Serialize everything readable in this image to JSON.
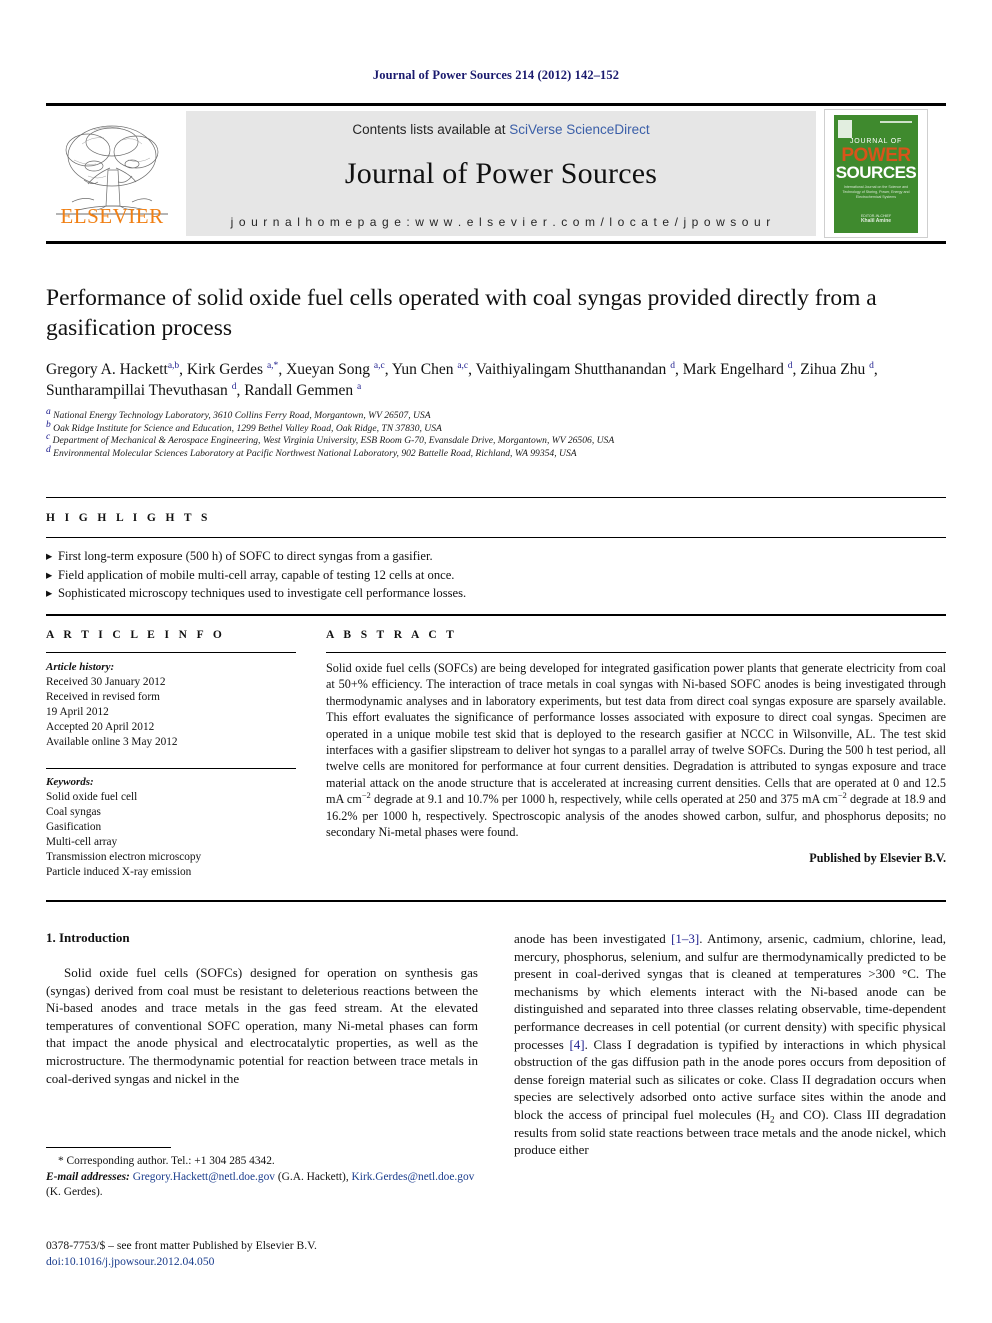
{
  "running_head": "Journal of Power Sources 214 (2012) 142–152",
  "masthead": {
    "publisher_name": "ELSEVIER",
    "contents_prefix": "Contents lists available at ",
    "contents_link": "SciVerse ScienceDirect",
    "journal_name": "Journal of Power Sources",
    "homepage": "j o u r n a l   h o m e p a g e :   w w w . e l s e v i e r . c o m / l o c a t e / j p o w s o u r",
    "cover": {
      "journal_of": "JOURNAL OF",
      "power": "POWER",
      "sources": "SOURCES",
      "subtitle": "International Journal on the Science and Technology of Storing, Power, Energy and Electrochemical Systems",
      "editor_label": "EDITOR-IN-CHIEF",
      "editor": "Khalil Amine"
    }
  },
  "title": "Performance of solid oxide fuel cells operated with coal syngas provided directly from a gasification process",
  "authors_line_1": "Gregory A. Hackett",
  "authors": "Gregory A. Hackett<sup>a,b</sup>, Kirk Gerdes <sup>a,*</sup>, Xueyan Song <sup>a,c</sup>, Yun Chen <sup>a,c</sup>, Vaithiyalingam Shutthanandan <sup>d</sup>, Mark Engelhard <sup>d</sup>, Zihua Zhu <sup>d</sup>, Suntharampillai Thevuthasan <sup>d</sup>, Randall Gemmen <sup>a</sup>",
  "affiliations": [
    "<sup>a</sup> National Energy Technology Laboratory, 3610 Collins Ferry Road, Morgantown, WV 26507, USA",
    "<sup>b</sup> Oak Ridge Institute for Science and Education, 1299 Bethel Valley Road, Oak Ridge, TN 37830, USA",
    "<sup>c</sup> Department of Mechanical &amp; Aerospace Engineering, West Virginia University, ESB Room G-70, Evansdale Drive, Morgantown, WV 26506, USA",
    "<sup>d</sup> Environmental Molecular Sciences Laboratory at Pacific Northwest National Laboratory, 902 Battelle Road, Richland, WA 99354, USA"
  ],
  "highlights": {
    "label": "H I G H L I G H T S",
    "items": [
      "First long-term exposure (500 h) of SOFC to direct syngas from a gasifier.",
      "Field application of mobile multi-cell array, capable of testing 12 cells at once.",
      "Sophisticated microscopy techniques used to investigate cell performance losses."
    ],
    "bullet": "triangle-right-icon"
  },
  "article_info": {
    "label": "A R T I C L E   I N F O",
    "history_label": "Article history:",
    "history": [
      "Received 30 January 2012",
      "Received in revised form",
      "19 April 2012",
      "Accepted 20 April 2012",
      "Available online 3 May 2012"
    ],
    "keywords_label": "Keywords:",
    "keywords": [
      "Solid oxide fuel cell",
      "Coal syngas",
      "Gasification",
      "Multi-cell array",
      "Transmission electron microscopy",
      "Particle induced X-ray emission"
    ]
  },
  "abstract": {
    "label": "A B S T R A C T",
    "text": "Solid oxide fuel cells (SOFCs) are being developed for integrated gasification power plants that generate electricity from coal at 50+% efficiency. The interaction of trace metals in coal syngas with Ni-based SOFC anodes is being investigated through thermodynamic analyses and in laboratory experiments, but test data from direct coal syngas exposure are sparsely available. This effort evaluates the significance of performance losses associated with exposure to direct coal syngas. Specimen are operated in a unique mobile test skid that is deployed to the research gasifier at NCCC in Wilsonville, AL. The test skid interfaces with a gasifier slipstream to deliver hot syngas to a parallel array of twelve SOFCs. During the 500 h test period, all twelve cells are monitored for performance at four current densities. Degradation is attributed to syngas exposure and trace material attack on the anode structure that is accelerated at increasing current densities. Cells that are operated at 0 and 12.5 mA cm<sup>−2</sup> degrade at 9.1 and 10.7% per 1000 h, respectively, while cells operated at 250 and 375 mA cm<sup>−2</sup> degrade at 18.9 and 16.2% per 1000 h, respectively. Spectroscopic analysis of the anodes showed carbon, sulfur, and phosphorus deposits; no secondary Ni-metal phases were found.",
    "published_by": "Published by Elsevier B.V."
  },
  "body": {
    "section_heading": "1.  Introduction",
    "left_paragraph": "Solid oxide fuel cells (SOFCs) designed for operation on synthesis gas (syngas) derived from coal must be resistant to deleterious reactions between the Ni-based anodes and trace metals in the gas feed stream. At the elevated temperatures of conventional SOFC operation, many Ni-metal phases can form that impact the anode physical and electrocatalytic properties, as well as the microstructure. The thermodynamic potential for reaction between trace metals in coal-derived syngas and nickel in the",
    "right_paragraph": "anode has been investigated <span class=\"ref-link\">[1–3]</span>. Antimony, arsenic, cadmium, chlorine, lead, mercury, phosphorus, selenium, and sulfur are thermodynamically predicted to be present in coal-derived syngas that is cleaned at temperatures &gt;300 °C. The mechanisms by which elements interact with the Ni-based anode can be distinguished and separated into three classes relating observable, time-dependent performance decreases in cell potential (or current density) with specific physical processes <span class=\"ref-link\">[4]</span>. Class I degradation is typified by interactions in which physical obstruction of the gas diffusion path in the anode pores occurs from deposition of dense foreign material such as silicates or coke. Class II degradation occurs when species are selectively adsorbed onto active surface sites within the anode and block the access of principal fuel molecules (H<sub>2</sub> and CO). Class III degradation results from solid state reactions between trace metals and the anode nickel, which produce either"
  },
  "footnotes": {
    "corresponding": "* Corresponding author. Tel.: +1 304 285 4342.",
    "email_label": "E-mail addresses:",
    "email_text": " <span class=\"email\">Gregory.Hackett@netl.doe.gov</span> (G.A. Hackett), <span class=\"email\">Kirk.Gerdes@netl.doe.gov</span> (K. Gerdes).",
    "issn_line": "0378-7753/$ – see front matter Published by Elsevier B.V.",
    "doi_line": "doi:10.1016/j.jpowsour.2012.04.050"
  },
  "colors": {
    "link": "#3b5fa8",
    "ref": "#1a1a8c",
    "running_head": "#1a1a6e",
    "elsevier_orange": "#F07F13",
    "cover_green": "#3f8a2e",
    "banner_gray": "#e6e6e6"
  }
}
